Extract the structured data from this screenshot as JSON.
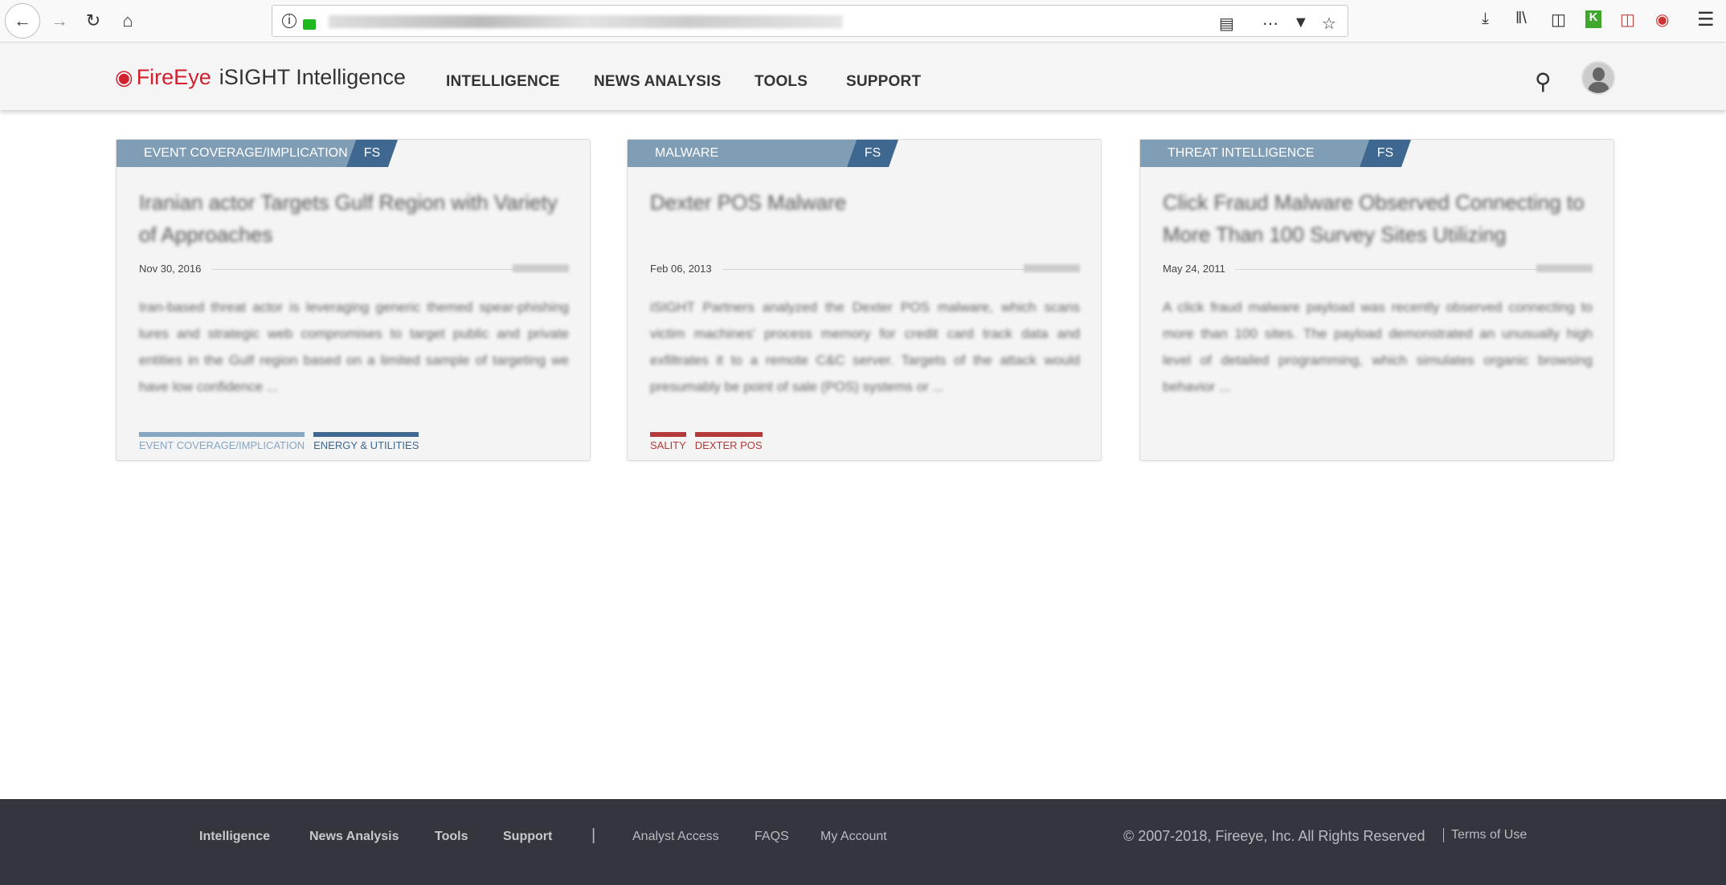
{
  "browser": {
    "icons": [
      "back-icon",
      "forward-icon",
      "reload-icon",
      "home-icon",
      "info-icon",
      "lock-icon",
      "reader-icon",
      "more-icon",
      "pocket-icon",
      "star-icon",
      "download-icon",
      "library-icon",
      "sidebar-icon",
      "extension-icon",
      "pdf-icon",
      "fireeye-extension-icon",
      "menu-icon"
    ]
  },
  "header": {
    "logo_brand": "FireEye",
    "logo_product": "iSIGHT Intelligence",
    "nav": [
      "INTELLIGENCE",
      "NEWS ANALYSIS",
      "TOOLS",
      "SUPPORT"
    ]
  },
  "cards": [
    {
      "category": "EVENT COVERAGE/IMPLICATION",
      "badge": "FS",
      "title": "Iranian actor Targets Gulf Region with Variety of Approaches",
      "date": "Nov 30, 2016",
      "summary": "Iran-based threat actor is leveraging generic themed spear-phishing lures and strategic web compromises to target public and private entities in the Gulf region based on a limited sample of targeting we have low confidence ...",
      "tags": [
        {
          "label": "EVENT COVERAGE/IMPLICATION",
          "color": "#86a6c2"
        },
        {
          "label": "ENERGY & UTILITIES",
          "color": "#3f6890"
        }
      ]
    },
    {
      "category": "MALWARE",
      "badge": "FS",
      "title": "Dexter POS Malware",
      "date": "Feb 06, 2013",
      "summary": "iSIGHT Partners analyzed the Dexter POS malware, which scans victim machines' process memory for credit card track data and exfiltrates it to a remote C&C server. Targets of the attack would presumably be point of sale (POS) systems or ...",
      "tags": [
        {
          "label": "SALITY",
          "color": "#b53a3a"
        },
        {
          "label": "DEXTER POS",
          "color": "#b53a3a"
        }
      ]
    },
    {
      "category": "THREAT INTELLIGENCE",
      "badge": "FS",
      "title": "Click Fraud Malware Observed Connecting to More Than 100 Survey Sites Utilizing",
      "date": "May 24, 2011",
      "summary": "A click fraud malware payload was recently observed connecting to more than 100 sites. The payload demonstrated an unusually high level of detailed programming, which simulates organic browsing behavior ...",
      "tags": []
    }
  ],
  "footer": {
    "links": [
      "Intelligence",
      "News Analysis",
      "Tools",
      "Support"
    ],
    "separator": "|",
    "secondary": [
      "Analyst Access",
      "FAQS",
      "My Account"
    ],
    "copyright": "© 2007-2018, Fireeye, Inc. All Rights Reserved",
    "terms": "Terms of Use"
  }
}
